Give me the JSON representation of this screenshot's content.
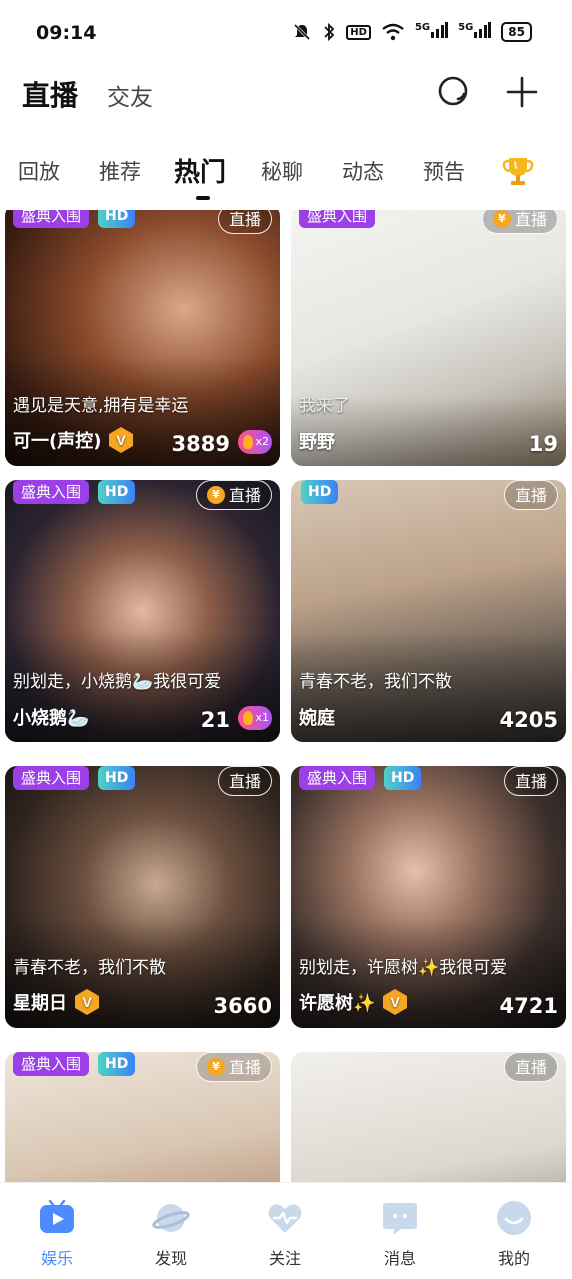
{
  "status_bar": {
    "time": "09:14",
    "hd_label": "HD",
    "signal_1": "5G",
    "signal_2": "5G",
    "battery": "85",
    "icons": [
      "mute-icon",
      "bluetooth-icon",
      "hd-icon",
      "wifi-icon",
      "signal-icon",
      "signal-icon",
      "battery-icon"
    ]
  },
  "header": {
    "tab_live": "直播",
    "tab_friends": "交友",
    "search_icon": "search-icon",
    "add_icon": "plus-icon"
  },
  "categories": {
    "items": [
      "回放",
      "推荐",
      "热门",
      "秘聊",
      "动态",
      "预告"
    ],
    "active": "热门",
    "trophy_icon": "trophy-icon"
  },
  "badges": {
    "ceremony": "盛典入围",
    "hd": "HD",
    "live": "直播",
    "coin": "¥"
  },
  "cards": [
    {
      "desc": "遇见是天意,拥有是幸运",
      "name": "可一(声控)",
      "count": "3889",
      "fire": "x2"
    },
    {
      "desc": "我来了",
      "name": "野野",
      "count": "19"
    },
    {
      "desc": "别划走，小烧鹅🦢我很可爱",
      "name": "小烧鹅🦢",
      "count": "21",
      "fire": "x1"
    },
    {
      "desc": "青春不老，我们不散",
      "name": "婉庭",
      "count": "4205"
    },
    {
      "desc": "青春不老，我们不散",
      "name": "星期日",
      "count": "3660"
    },
    {
      "desc": "别划走，许愿树✨我很可爱",
      "name": "许愿树✨",
      "count": "4721"
    },
    {
      "desc": "",
      "name": "",
      "count": ""
    },
    {
      "desc": "",
      "name": "",
      "count": ""
    }
  ],
  "bottom_nav": {
    "items": [
      {
        "label": "娱乐",
        "icon": "tv-icon",
        "active": true
      },
      {
        "label": "发现",
        "icon": "planet-icon",
        "active": false
      },
      {
        "label": "关注",
        "icon": "heart-pulse-icon",
        "active": false
      },
      {
        "label": "消息",
        "icon": "chat-icon",
        "active": false
      },
      {
        "label": "我的",
        "icon": "profile-icon",
        "active": false
      }
    ],
    "active_color": "#4d8cff"
  },
  "colors": {
    "ceremony_badge": "#9b3fe6",
    "hd_badge_start": "#4fd1c5",
    "hd_badge_end": "#3b82f6",
    "coin": "#f5a623",
    "nav_active": "#4d8cff"
  }
}
